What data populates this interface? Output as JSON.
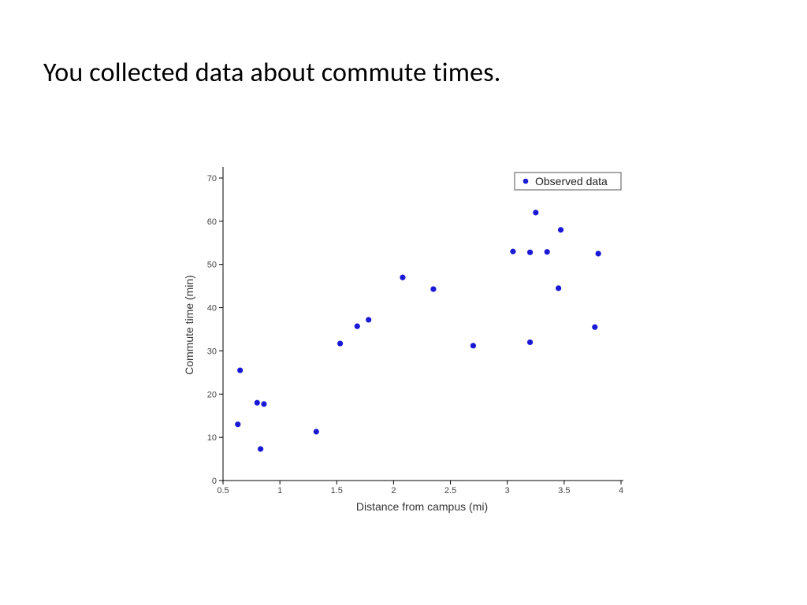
{
  "title": "You collected data about commute times.",
  "chart_data": {
    "type": "scatter",
    "title": "",
    "xlabel": "Distance from campus (mi)",
    "ylabel": "Commute time (min)",
    "xlim": [
      0.5,
      4.0
    ],
    "ylim": [
      0,
      72
    ],
    "xticks": [
      0.5,
      1,
      1.5,
      2,
      2.5,
      3,
      3.5,
      4
    ],
    "yticks": [
      0,
      10,
      20,
      30,
      40,
      50,
      60,
      70
    ],
    "legend": {
      "position": "top-right",
      "entries": [
        "Observed data"
      ]
    },
    "series": [
      {
        "name": "Observed data",
        "x": [
          0.63,
          0.65,
          0.8,
          0.83,
          0.86,
          1.32,
          1.53,
          1.68,
          1.78,
          2.08,
          2.35,
          2.7,
          3.05,
          3.2,
          3.2,
          3.25,
          3.35,
          3.45,
          3.47,
          3.77,
          3.8
        ],
        "y": [
          13,
          25.5,
          18,
          7.3,
          17.7,
          11.3,
          31.7,
          35.7,
          37.2,
          47,
          44.3,
          31.2,
          53,
          32,
          52.8,
          62,
          52.9,
          44.5,
          58,
          35.5,
          52.5
        ]
      }
    ]
  }
}
